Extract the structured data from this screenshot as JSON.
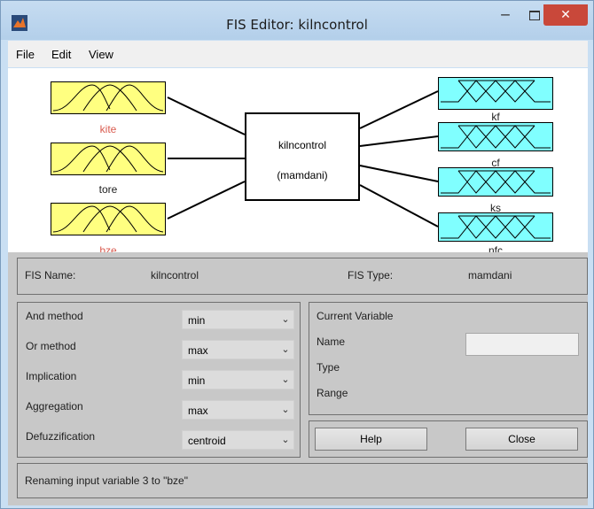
{
  "window": {
    "title": "FIS Editor: kilncontrol",
    "minimize_glyph": "‒",
    "close_glyph": "✕"
  },
  "menu": [
    "File",
    "Edit",
    "View"
  ],
  "diagram": {
    "inputs": [
      {
        "name": "kite",
        "label_color": "#d95b4f"
      },
      {
        "name": "tore",
        "label_color": "#202020"
      },
      {
        "name": "bze",
        "label_color": "#d95b4f"
      }
    ],
    "outputs": [
      {
        "name": "kf"
      },
      {
        "name": "cf"
      },
      {
        "name": "ks"
      },
      {
        "name": "nfc"
      }
    ],
    "system_name": "kilncontrol",
    "system_type": "(mamdani)",
    "input_color": "#ffff80",
    "output_color": "#80ffff"
  },
  "info": {
    "fis_name_label": "FIS Name:",
    "fis_name": "kilncontrol",
    "fis_type_label": "FIS Type:",
    "fis_type": "mamdani"
  },
  "methods": [
    {
      "label": "And method",
      "value": "min"
    },
    {
      "label": "Or method",
      "value": "max"
    },
    {
      "label": "Implication",
      "value": "min"
    },
    {
      "label": "Aggregation",
      "value": "max"
    },
    {
      "label": "Defuzzification",
      "value": "centroid"
    }
  ],
  "current_variable": {
    "title": "Current Variable",
    "name_label": "Name",
    "name_value": "",
    "type_label": "Type",
    "range_label": "Range"
  },
  "buttons": {
    "help": "Help",
    "close": "Close"
  },
  "status": "Renaming input variable 3 to \"bze\""
}
